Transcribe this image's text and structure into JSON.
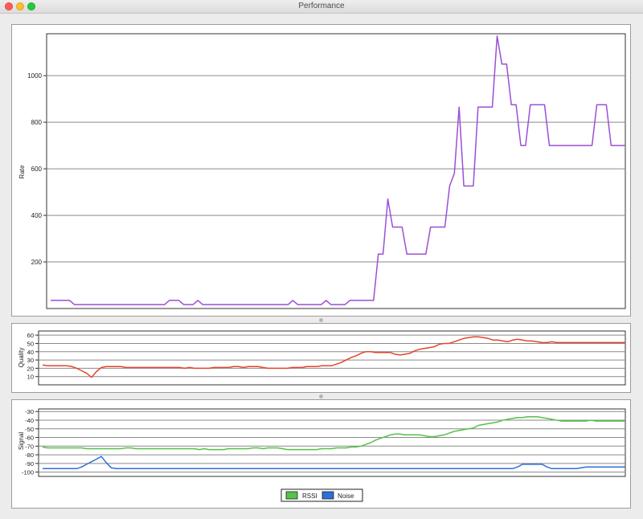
{
  "window": {
    "title": "Performance"
  },
  "charts": {
    "rate": {
      "ylabel": "Rate"
    },
    "quality": {
      "ylabel": "Quality"
    },
    "signal": {
      "ylabel": "Signal"
    }
  },
  "legend": {
    "items": [
      {
        "label": "RSSI",
        "color": "#55c24a"
      },
      {
        "label": "Noise",
        "color": "#2f6fd8"
      }
    ]
  },
  "chart_data": [
    {
      "type": "line",
      "title": "",
      "ylabel": "Rate",
      "ylim": [
        0,
        1180
      ],
      "yticks": [
        200,
        400,
        600,
        800,
        1000
      ],
      "grid": true,
      "x": [
        0,
        1,
        2,
        3,
        4,
        5,
        6,
        7,
        8,
        9,
        10,
        11,
        12,
        13,
        14,
        15,
        16,
        17,
        18,
        19,
        20,
        21,
        22,
        23,
        24,
        25,
        26,
        27,
        28,
        29,
        30,
        31,
        32,
        33,
        34,
        35,
        36,
        37,
        38,
        39,
        40,
        41,
        42,
        43,
        44,
        45,
        46,
        47,
        48,
        49,
        50,
        51,
        52,
        53,
        54,
        55,
        56,
        57,
        58,
        59,
        60,
        61,
        62,
        63,
        64,
        65,
        66,
        67,
        68,
        69,
        70,
        71,
        72,
        73,
        74,
        75,
        76,
        77,
        78,
        79,
        80,
        81,
        82,
        83,
        84,
        85,
        86,
        87,
        88,
        89,
        90,
        91,
        92,
        93,
        94,
        95,
        96,
        97,
        98,
        99,
        100,
        101,
        102,
        103,
        104,
        105,
        106,
        107,
        108,
        109,
        110,
        111,
        112,
        113,
        114,
        115,
        116,
        117,
        118,
        119
      ],
      "series": [
        {
          "name": "",
          "color": "#9b4fd6",
          "values": [
            35,
            35,
            35,
            35,
            35,
            17,
            17,
            17,
            17,
            17,
            17,
            17,
            17,
            17,
            17,
            17,
            17,
            17,
            17,
            17,
            17,
            17,
            17,
            17,
            17,
            35,
            35,
            35,
            17,
            17,
            17,
            35,
            17,
            17,
            17,
            17,
            17,
            17,
            17,
            17,
            17,
            17,
            17,
            17,
            17,
            17,
            17,
            17,
            17,
            17,
            17,
            35,
            17,
            17,
            17,
            17,
            17,
            17,
            35,
            17,
            17,
            17,
            17,
            35,
            35,
            35,
            35,
            35,
            35,
            234,
            234,
            470,
            350,
            350,
            350,
            234,
            234,
            234,
            234,
            234,
            350,
            350,
            350,
            350,
            526,
            580,
            865,
            526,
            526,
            526,
            865,
            865,
            865,
            865,
            1170,
            1050,
            1050,
            875,
            875,
            700,
            700,
            875,
            875,
            875,
            875,
            700,
            700,
            700,
            700,
            700,
            700,
            700,
            700,
            700,
            700,
            875,
            875,
            875,
            700,
            700,
            700,
            700
          ]
        }
      ]
    },
    {
      "type": "line",
      "title": "",
      "ylabel": "Quality",
      "ylim": [
        0,
        65
      ],
      "yticks": [
        10,
        20,
        30,
        40,
        50,
        60
      ],
      "grid": true,
      "series": [
        {
          "name": "",
          "color": "#e2462f",
          "values": [
            24,
            23,
            23,
            23,
            23,
            23,
            22,
            20,
            17,
            14,
            9,
            16,
            21,
            22,
            22,
            22,
            22,
            21,
            21,
            21,
            21,
            21,
            21,
            21,
            21,
            21,
            21,
            21,
            21,
            20,
            21,
            20,
            20,
            20,
            20,
            21,
            21,
            21,
            21,
            22,
            22,
            21,
            22,
            22,
            22,
            21,
            20,
            20,
            20,
            20,
            20,
            21,
            21,
            21,
            22,
            22,
            22,
            23,
            23,
            23,
            25,
            27,
            30,
            33,
            35,
            38,
            40,
            40,
            39,
            39,
            39,
            39,
            37,
            36,
            37,
            38,
            41,
            43,
            44,
            45,
            46,
            49,
            50,
            50,
            52,
            54,
            56,
            57,
            58,
            58,
            57,
            56,
            54,
            54,
            53,
            52,
            54,
            55,
            54,
            53,
            53,
            52,
            51,
            51,
            52,
            51,
            51,
            51,
            51,
            51,
            51,
            51,
            51,
            51,
            51,
            51,
            51,
            51,
            51,
            51
          ]
        }
      ]
    },
    {
      "type": "line",
      "title": "",
      "ylabel": "Signal",
      "ylim": [
        -105,
        -27
      ],
      "yticks": [
        -30,
        -40,
        -50,
        -60,
        -70,
        -80,
        -90,
        -100
      ],
      "grid": true,
      "legend": "bottom-center",
      "series": [
        {
          "name": "RSSI",
          "color": "#55c24a",
          "values": [
            -71,
            -72,
            -72,
            -72,
            -72,
            -72,
            -72,
            -72,
            -72,
            -73,
            -73,
            -73,
            -73,
            -73,
            -73,
            -73,
            -73,
            -72,
            -72,
            -73,
            -73,
            -73,
            -73,
            -73,
            -73,
            -73,
            -73,
            -73,
            -73,
            -73,
            -73,
            -73,
            -74,
            -73,
            -74,
            -74,
            -74,
            -74,
            -73,
            -73,
            -73,
            -73,
            -73,
            -72,
            -72,
            -73,
            -72,
            -72,
            -72,
            -73,
            -74,
            -74,
            -74,
            -74,
            -74,
            -74,
            -74,
            -73,
            -73,
            -73,
            -72,
            -72,
            -72,
            -71,
            -71,
            -70,
            -68,
            -66,
            -63,
            -61,
            -59,
            -57,
            -56,
            -56,
            -57,
            -57,
            -57,
            -57,
            -58,
            -59,
            -59,
            -58,
            -57,
            -55,
            -53,
            -52,
            -51,
            -50,
            -49,
            -46,
            -45,
            -44,
            -43,
            -42,
            -40,
            -39,
            -38,
            -37,
            -37,
            -36,
            -36,
            -36,
            -37,
            -38,
            -39,
            -40,
            -41,
            -41,
            -41,
            -41,
            -41,
            -41,
            -40,
            -41,
            -41,
            -41,
            -41,
            -41,
            -41,
            -41
          ]
        },
        {
          "name": "Noise",
          "color": "#2f6fd8",
          "values": [
            -96,
            -96,
            -96,
            -96,
            -96,
            -96,
            -96,
            -96,
            -94,
            -91,
            -88,
            -85,
            -82,
            -89,
            -95,
            -96,
            -96,
            -96,
            -96,
            -96,
            -96,
            -96,
            -96,
            -96,
            -96,
            -96,
            -96,
            -96,
            -96,
            -96,
            -96,
            -96,
            -96,
            -96,
            -96,
            -96,
            -96,
            -96,
            -96,
            -96,
            -96,
            -96,
            -96,
            -96,
            -96,
            -96,
            -96,
            -96,
            -96,
            -96,
            -96,
            -96,
            -96,
            -96,
            -96,
            -96,
            -96,
            -96,
            -96,
            -96,
            -96,
            -96,
            -96,
            -96,
            -96,
            -96,
            -96,
            -96,
            -96,
            -96,
            -96,
            -96,
            -96,
            -96,
            -96,
            -96,
            -96,
            -96,
            -96,
            -96,
            -96,
            -96,
            -96,
            -96,
            -96,
            -96,
            -96,
            -96,
            -96,
            -96,
            -96,
            -96,
            -96,
            -96,
            -96,
            -96,
            -96,
            -94,
            -91,
            -91,
            -91,
            -91,
            -91,
            -94,
            -96,
            -96,
            -96,
            -96,
            -96,
            -96,
            -95,
            -94,
            -94,
            -94,
            -94,
            -94,
            -94,
            -94,
            -94,
            -94
          ]
        }
      ]
    }
  ]
}
